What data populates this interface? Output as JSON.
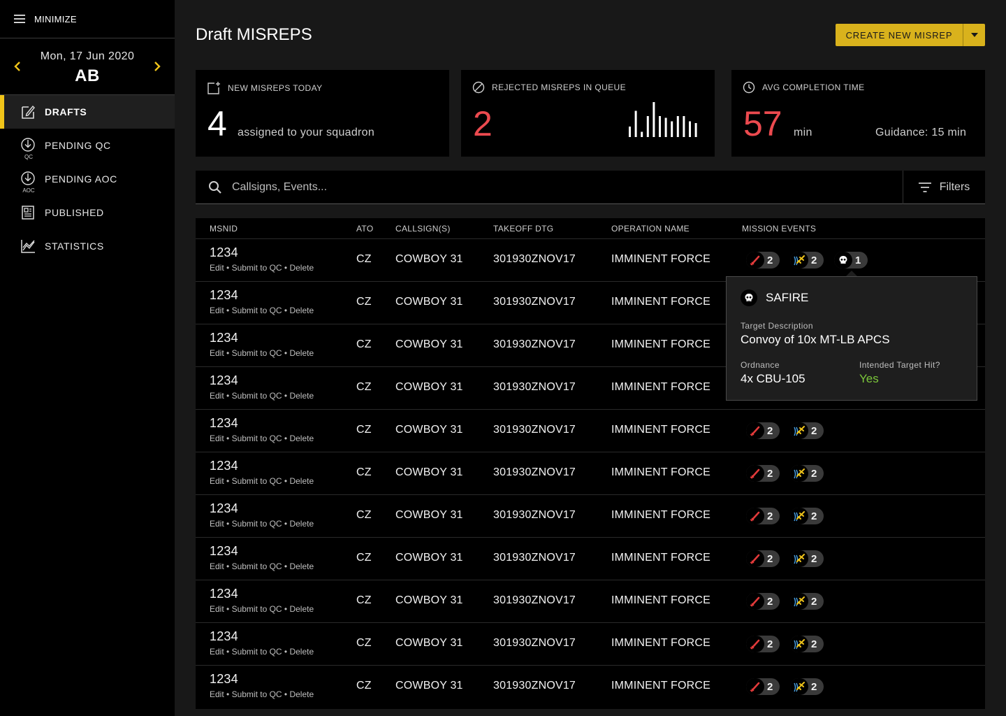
{
  "sidebar": {
    "minimize_label": "MINIMIZE",
    "date": "Mon, 17 Jun 2020",
    "unit": "AB",
    "items": [
      {
        "label": "DRAFTS",
        "sub": ""
      },
      {
        "label": "PENDING QC",
        "sub": "QC"
      },
      {
        "label": "PENDING AOC",
        "sub": "AOC"
      },
      {
        "label": "PUBLISHED",
        "sub": ""
      },
      {
        "label": "STATISTICS",
        "sub": ""
      }
    ]
  },
  "header": {
    "title": "Draft MISREPS",
    "create_label": "CREATE NEW MISREP"
  },
  "cards": {
    "new_today": {
      "label": "NEW MISREPS TODAY",
      "value": "4",
      "note": "assigned to your squadron"
    },
    "rejected": {
      "label": "REJECTED MISREPS IN QUEUE",
      "value": "2",
      "sparkline": [
        0.3,
        0.75,
        0.15,
        0.6,
        1.0,
        0.6,
        0.55,
        0.45,
        0.6,
        0.6,
        0.45,
        0.4
      ]
    },
    "avg_time": {
      "label": "AVG COMPLETION TIME",
      "value": "57",
      "unit": "min",
      "guidance": "Guidance: 15 min"
    }
  },
  "search": {
    "placeholder": "Callsigns, Events...",
    "filters_label": "Filters"
  },
  "table": {
    "headers": {
      "msnid": "MSNID",
      "ato": "ATO",
      "callsign": "CALLSIGN(S)",
      "takeoff": "TAKEOFF DTG",
      "operation": "OPERATION NAME",
      "events": "MISSION EVENTS"
    },
    "action_labels": {
      "edit": "Edit",
      "submit": "Submit to QC",
      "delete": "Delete"
    },
    "rows": [
      {
        "msnid": "1234",
        "ato": "CZ",
        "callsign": "COWBOY 31",
        "takeoff": "301930ZNOV17",
        "operation": "IMMINENT FORCE",
        "strike": "2",
        "aircraft": "2",
        "threat": "1"
      },
      {
        "msnid": "1234",
        "ato": "CZ",
        "callsign": "COWBOY 31",
        "takeoff": "301930ZNOV17",
        "operation": "IMMINENT FORCE",
        "strike": "2",
        "aircraft": "2",
        "threat": ""
      },
      {
        "msnid": "1234",
        "ato": "CZ",
        "callsign": "COWBOY 31",
        "takeoff": "301930ZNOV17",
        "operation": "IMMINENT FORCE",
        "strike": "2",
        "aircraft": "2",
        "threat": ""
      },
      {
        "msnid": "1234",
        "ato": "CZ",
        "callsign": "COWBOY 31",
        "takeoff": "301930ZNOV17",
        "operation": "IMMINENT FORCE",
        "strike": "2",
        "aircraft": "2",
        "threat": ""
      },
      {
        "msnid": "1234",
        "ato": "CZ",
        "callsign": "COWBOY 31",
        "takeoff": "301930ZNOV17",
        "operation": "IMMINENT FORCE",
        "strike": "2",
        "aircraft": "2",
        "threat": ""
      },
      {
        "msnid": "1234",
        "ato": "CZ",
        "callsign": "COWBOY 31",
        "takeoff": "301930ZNOV17",
        "operation": "IMMINENT FORCE",
        "strike": "2",
        "aircraft": "2",
        "threat": ""
      },
      {
        "msnid": "1234",
        "ato": "CZ",
        "callsign": "COWBOY 31",
        "takeoff": "301930ZNOV17",
        "operation": "IMMINENT FORCE",
        "strike": "2",
        "aircraft": "2",
        "threat": ""
      },
      {
        "msnid": "1234",
        "ato": "CZ",
        "callsign": "COWBOY 31",
        "takeoff": "301930ZNOV17",
        "operation": "IMMINENT FORCE",
        "strike": "2",
        "aircraft": "2",
        "threat": ""
      },
      {
        "msnid": "1234",
        "ato": "CZ",
        "callsign": "COWBOY 31",
        "takeoff": "301930ZNOV17",
        "operation": "IMMINENT FORCE",
        "strike": "2",
        "aircraft": "2",
        "threat": ""
      },
      {
        "msnid": "1234",
        "ato": "CZ",
        "callsign": "COWBOY 31",
        "takeoff": "301930ZNOV17",
        "operation": "IMMINENT FORCE",
        "strike": "2",
        "aircraft": "2",
        "threat": ""
      },
      {
        "msnid": "1234",
        "ato": "CZ",
        "callsign": "COWBOY 31",
        "takeoff": "301930ZNOV17",
        "operation": "IMMINENT FORCE",
        "strike": "2",
        "aircraft": "2",
        "threat": ""
      }
    ]
  },
  "popover": {
    "title": "SAFIRE",
    "target_label": "Target Description",
    "target_value": "Convoy of 10x MT-LB APCS",
    "ordnance_label": "Ordnance",
    "ordnance_value": "4x CBU-105",
    "hit_label": "Intended Target Hit?",
    "hit_value": "Yes"
  },
  "colors": {
    "accent": "#d9b21c",
    "alert": "#ec4a4f",
    "success": "#7bc63a"
  }
}
